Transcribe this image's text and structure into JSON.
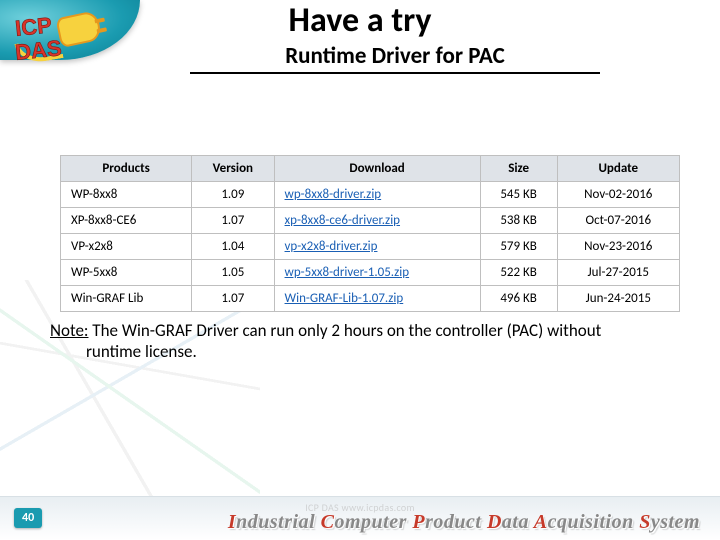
{
  "title": "Have a try",
  "subtitle": "Runtime Driver for PAC",
  "table": {
    "headers": [
      "Products",
      "Version",
      "Download",
      "Size",
      "Update"
    ],
    "rows": [
      {
        "product": "WP-8xx8",
        "version": "1.09",
        "download": "wp-8xx8-driver.zip",
        "size": "545 KB",
        "update": "Nov-02-2016"
      },
      {
        "product": "XP-8xx8-CE6",
        "version": "1.07",
        "download": "xp-8xx8-ce6-driver.zip",
        "size": "538 KB",
        "update": "Oct-07-2016"
      },
      {
        "product": "VP-x2x8",
        "version": "1.04",
        "download": "vp-x2x8-driver.zip",
        "size": "579 KB",
        "update": "Nov-23-2016"
      },
      {
        "product": "WP-5xx8",
        "version": "1.05",
        "download": "wp-5xx8-driver-1.05.zip",
        "size": "522 KB",
        "update": "Jul-27-2015"
      },
      {
        "product": "Win-GRAF Lib",
        "version": "1.07",
        "download": "Win-GRAF-Lib-1.07.zip",
        "size": "496 KB",
        "update": "Jun-24-2015"
      }
    ]
  },
  "note": {
    "prefix": "Note:",
    "line1": " The Win-GRAF Driver can run only 2 hours on the controller (PAC) without",
    "line2": "runtime license."
  },
  "footer": {
    "page": "40",
    "url": "ICP DAS    www.icpdas.com",
    "brand_parts": {
      "i": "I",
      "ndustrial": "ndustrial ",
      "c": "C",
      "omputer": "omputer ",
      "p": "P",
      "roduct": "roduct ",
      "d": "D",
      "ata": "ata ",
      "a": "A",
      "cquisition": "cquisition ",
      "s": "S",
      "ystem": "ystem"
    }
  },
  "logo": {
    "line1": "ICP",
    "line2": "DAS"
  }
}
